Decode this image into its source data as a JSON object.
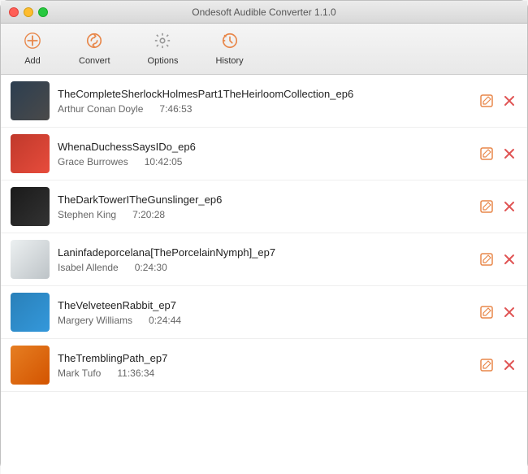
{
  "window": {
    "title": "Ondesoft Audible Converter 1.1.0"
  },
  "toolbar": {
    "add_label": "Add",
    "convert_label": "Convert",
    "options_label": "Options",
    "history_label": "History"
  },
  "books": [
    {
      "id": 1,
      "title": "TheCompleteSherlockHolmesPart1TheHeirloomCollection_ep6",
      "author": "Arthur Conan Doyle",
      "duration": "7:46:53",
      "cover_class": "cover-1"
    },
    {
      "id": 2,
      "title": "WhenaDuchessSaysIDo_ep6",
      "author": "Grace Burrowes",
      "duration": "10:42:05",
      "cover_class": "cover-2"
    },
    {
      "id": 3,
      "title": "TheDarkTowerITheGunslinger_ep6",
      "author": "Stephen King",
      "duration": "7:20:28",
      "cover_class": "cover-3"
    },
    {
      "id": 4,
      "title": "Laninfadeporcelana[ThePorcelainNymph]_ep7",
      "author": "Isabel Allende",
      "duration": "0:24:30",
      "cover_class": "cover-4"
    },
    {
      "id": 5,
      "title": "TheVelveteenRabbit_ep7",
      "author": "Margery Williams",
      "duration": "0:24:44",
      "cover_class": "cover-5"
    },
    {
      "id": 6,
      "title": "TheTremblingPath_ep7",
      "author": "Mark Tufo",
      "duration": "11:36:34",
      "cover_class": "cover-6"
    }
  ]
}
